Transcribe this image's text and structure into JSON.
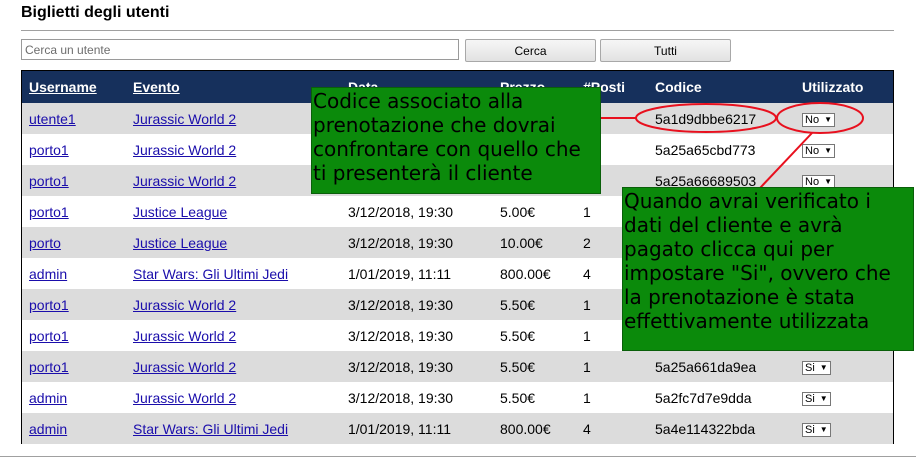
{
  "page": {
    "title": "Biglietti degli utenti"
  },
  "search": {
    "placeholder": "Cerca un utente",
    "value": "",
    "search_label": "Cerca",
    "all_label": "Tutti"
  },
  "table": {
    "columns": [
      "Username",
      "Evento",
      "Data",
      "Prezzo",
      "#Posti",
      "Codice",
      "Utilizzato"
    ],
    "rows": [
      {
        "username": "utente1",
        "event": "Jurassic World 2",
        "date": "",
        "price": "",
        "seats": "",
        "code": "5a1d9dbbe6217",
        "used": "No"
      },
      {
        "username": "porto1",
        "event": "Jurassic World 2",
        "date": "",
        "price": "",
        "seats": "",
        "code": "5a25a65cbd773",
        "used": "No"
      },
      {
        "username": "porto1",
        "event": "Jurassic World 2",
        "date": "",
        "price": "",
        "seats": "",
        "code": "5a25a66689503",
        "used": "No"
      },
      {
        "username": "porto1",
        "event": "Justice League",
        "date": "3/12/2018, 19:30",
        "price": "5.00€",
        "seats": "1",
        "code": "",
        "used": ""
      },
      {
        "username": "porto",
        "event": "Justice League",
        "date": "3/12/2018, 19:30",
        "price": "10.00€",
        "seats": "2",
        "code": "",
        "used": ""
      },
      {
        "username": "admin",
        "event": "Star Wars: Gli Ultimi Jedi",
        "date": "1/01/2019, 11:11",
        "price": "800.00€",
        "seats": "4",
        "code": "",
        "used": ""
      },
      {
        "username": "porto1",
        "event": "Jurassic World 2",
        "date": "3/12/2018, 19:30",
        "price": "5.50€",
        "seats": "1",
        "code": "",
        "used": ""
      },
      {
        "username": "porto1",
        "event": "Jurassic World 2",
        "date": "3/12/2018, 19:30",
        "price": "5.50€",
        "seats": "1",
        "code": "",
        "used": ""
      },
      {
        "username": "porto1",
        "event": "Jurassic World 2",
        "date": "3/12/2018, 19:30",
        "price": "5.50€",
        "seats": "1",
        "code": "5a25a661da9ea",
        "used": "Si"
      },
      {
        "username": "admin",
        "event": "Jurassic World 2",
        "date": "3/12/2018, 19:30",
        "price": "5.50€",
        "seats": "1",
        "code": "5a2fc7d7e9dda",
        "used": "Si"
      },
      {
        "username": "admin",
        "event": "Star Wars: Gli Ultimi Jedi",
        "date": "1/01/2019, 11:11",
        "price": "800.00€",
        "seats": "4",
        "code": "5a4e114322bda",
        "used": "Si"
      }
    ]
  },
  "annotations": {
    "code_note": "Codice associato alla prenotazione che dovrai confrontare con quello che ti presenterà il cliente",
    "used_note": "Quando avrai verificato i dati del cliente e avrà pagato clicca qui per impostare \"Si\", ovvero che la prenotazione è stata effettivamente utilizzata",
    "color": "#0b8a0b",
    "marker_color": "#e8101e"
  },
  "colors": {
    "header_bg": "#16305c",
    "row_alt": "#dcdcdc",
    "link": "#1a0dab"
  }
}
